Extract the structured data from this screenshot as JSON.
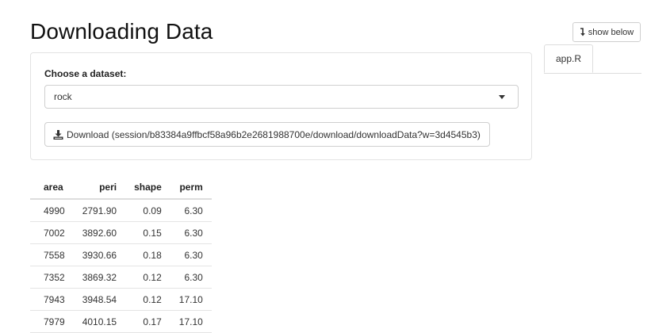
{
  "page": {
    "title": "Downloading Data"
  },
  "form": {
    "dataset_label": "Choose a dataset:",
    "dataset_selected": "rock",
    "download_label": "Download (session/b83384a9ffbcf58a96b2e2681988700e/download/downloadData?w=3d4545b3)"
  },
  "table": {
    "columns": [
      "area",
      "peri",
      "shape",
      "perm"
    ],
    "rows": [
      [
        "4990",
        "2791.90",
        "0.09",
        "6.30"
      ],
      [
        "7002",
        "3892.60",
        "0.15",
        "6.30"
      ],
      [
        "7558",
        "3930.66",
        "0.18",
        "6.30"
      ],
      [
        "7352",
        "3869.32",
        "0.12",
        "6.30"
      ],
      [
        "7943",
        "3948.54",
        "0.12",
        "17.10"
      ],
      [
        "7979",
        "4010.15",
        "0.17",
        "17.10"
      ]
    ]
  },
  "side": {
    "show_below_label": "show below",
    "code_tab_label": "app.R"
  },
  "icons": {
    "download": "download-icon",
    "show_below": "arrow-down-icon",
    "select": "caret-down-icon"
  }
}
